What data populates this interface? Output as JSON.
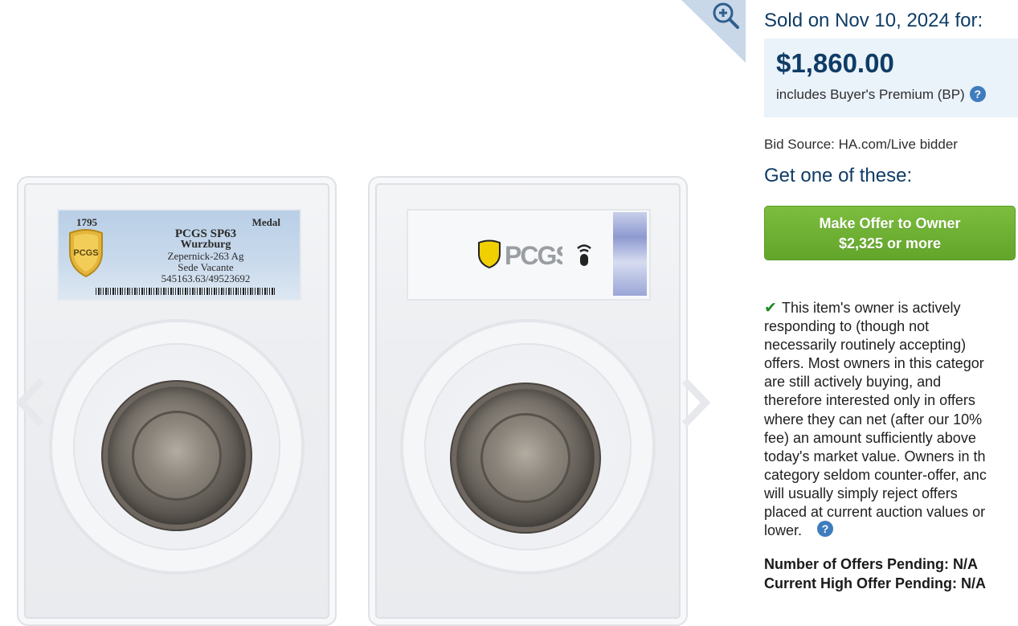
{
  "gallery": {
    "front_label": {
      "year": "1795",
      "type": "Medal",
      "grade": "PCGS SP63",
      "city": "Wurzburg",
      "reference": "Zepernick-263 Ag",
      "description": "Sede Vacante",
      "cert": "545163.63/49523692"
    },
    "logo_text": "PCGS",
    "icons": {
      "zoom": "zoom-in-icon",
      "prev": "chevron-left-icon",
      "next": "chevron-right-icon",
      "shield": "pcgs-shield-icon",
      "nfc": "nfc-chip-icon",
      "hologram": "hologram-icon"
    }
  },
  "panel": {
    "sold_line": "Sold on Nov 10, 2024 for:",
    "price": "$1,860.00",
    "bp_text": "includes Buyer's Premium (BP)",
    "help_glyph": "?",
    "bid_source": "Bid Source: HA.com/Live bidder",
    "get_one": "Get one of these:",
    "offer_button": {
      "line1": "Make Offer to Owner",
      "line2": "$2,325 or more"
    },
    "owner_lines": [
      "This item's owner is actively",
      "responding to (though not",
      "necessarily routinely accepting)",
      "offers. Most owners in this categor",
      "are still actively buying, and",
      "therefore interested only in offers",
      "where they can net (after our 10%",
      "fee) an amount sufficiently above",
      "today's market value. Owners in th",
      "category seldom counter-offer, anc",
      "will usually simply reject offers",
      "placed at current auction values or",
      "lower."
    ],
    "offers_pending": "Number of Offers Pending: N/A",
    "high_offer": "Current High Offer Pending: N/A"
  },
  "colors": {
    "heading": "#0f3c66",
    "price_bg": "#eaf2fa",
    "button_green": "#6aac2f",
    "help_blue": "#3f7cbd",
    "check_green": "#1f8a26"
  }
}
